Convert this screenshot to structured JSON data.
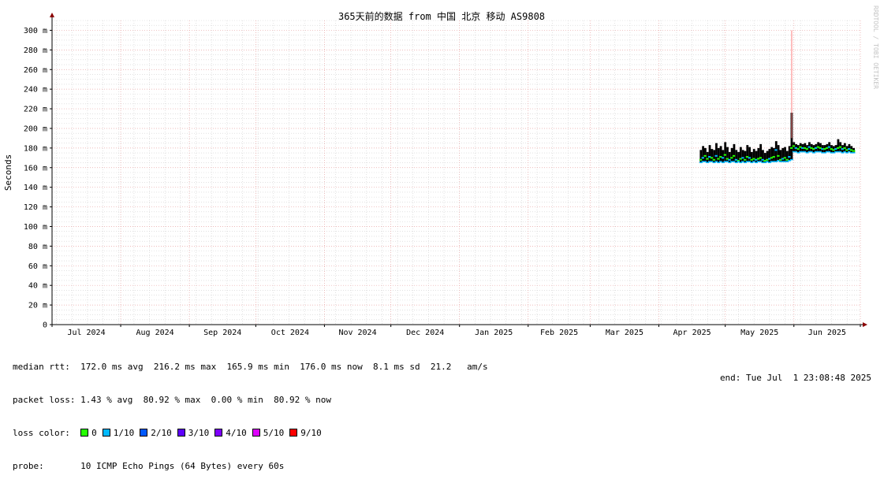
{
  "chart_data": {
    "type": "line",
    "title": "365天前的数据 from 中国 北京 移动 AS9808",
    "ylabel": "Seconds",
    "watermark": "RRDTOOL / TOBI OETIKER",
    "ylim": [
      0,
      310
    ],
    "yticks": [
      {
        "value": 0,
        "label": "0"
      },
      {
        "value": 20,
        "label": "20 m"
      },
      {
        "value": 40,
        "label": "40 m"
      },
      {
        "value": 60,
        "label": "60 m"
      },
      {
        "value": 80,
        "label": "80 m"
      },
      {
        "value": 100,
        "label": "100 m"
      },
      {
        "value": 120,
        "label": "120 m"
      },
      {
        "value": 140,
        "label": "140 m"
      },
      {
        "value": 160,
        "label": "160 m"
      },
      {
        "value": 180,
        "label": "180 m"
      },
      {
        "value": 200,
        "label": "200 m"
      },
      {
        "value": 220,
        "label": "220 m"
      },
      {
        "value": 240,
        "label": "240 m"
      },
      {
        "value": 260,
        "label": "260 m"
      },
      {
        "value": 280,
        "label": "280 m"
      },
      {
        "value": 300,
        "label": "300 m"
      }
    ],
    "xrange_days": [
      0,
      365
    ],
    "month_boundaries_days": [
      0,
      31,
      62,
      92,
      123,
      153,
      184,
      215,
      243,
      274,
      304,
      335,
      365
    ],
    "month_labels": [
      "Jul 2024",
      "Aug 2024",
      "Sep 2024",
      "Oct 2024",
      "Nov 2024",
      "Dec 2024",
      "Jan 2025",
      "Feb 2025",
      "Mar 2025",
      "Apr 2025",
      "May 2025",
      "Jun 2025"
    ],
    "grid": true,
    "series": [
      {
        "name": "median rtt",
        "x_days": [
          293,
          294,
          295,
          296,
          297,
          298,
          299,
          300,
          301,
          302,
          303,
          304,
          305,
          306,
          307,
          308,
          309,
          310,
          311,
          312,
          313,
          314,
          315,
          316,
          317,
          318,
          319,
          320,
          321,
          322,
          323,
          324,
          325,
          326,
          327,
          328,
          329,
          330,
          331,
          332,
          333,
          334,
          335,
          336,
          337,
          338,
          339,
          340,
          341,
          342,
          343,
          344,
          345,
          346,
          347,
          348,
          349,
          350,
          351,
          352,
          353,
          354,
          355,
          356,
          357,
          358,
          359,
          360,
          361,
          362
        ],
        "median_ms": [
          168,
          170,
          172,
          169,
          171,
          170,
          168,
          172,
          169,
          171,
          170,
          173,
          169,
          168,
          170,
          172,
          168,
          167,
          169,
          170,
          168,
          171,
          170,
          168,
          169,
          168,
          169,
          170,
          168,
          167,
          168,
          169,
          170,
          171,
          178,
          172,
          168,
          169,
          170,
          168,
          171,
          180,
          182,
          180,
          179,
          181,
          180,
          180,
          179,
          181,
          180,
          179,
          180,
          181,
          180,
          179,
          179,
          180,
          181,
          179,
          178,
          179,
          180,
          181,
          179,
          180,
          178,
          179,
          178,
          177
        ],
        "max_ms": [
          178,
          182,
          180,
          176,
          183,
          179,
          178,
          185,
          180,
          182,
          178,
          186,
          181,
          176,
          180,
          184,
          178,
          176,
          181,
          178,
          177,
          183,
          181,
          176,
          179,
          177,
          180,
          184,
          178,
          175,
          177,
          179,
          181,
          180,
          187,
          183,
          178,
          180,
          181,
          177,
          182,
          216,
          186,
          184,
          183,
          185,
          184,
          185,
          183,
          186,
          184,
          183,
          184,
          186,
          185,
          183,
          183,
          184,
          186,
          183,
          182,
          183,
          189,
          186,
          183,
          185,
          182,
          184,
          182,
          180
        ],
        "min_ms": [
          165,
          166,
          166,
          165,
          166,
          166,
          165,
          166,
          165,
          166,
          165,
          166,
          166,
          165,
          166,
          166,
          165,
          166,
          165,
          166,
          165,
          166,
          166,
          165,
          166,
          165,
          166,
          166,
          165,
          165,
          166,
          165,
          166,
          166,
          166,
          167,
          166,
          166,
          166,
          166,
          167,
          168,
          176,
          176,
          175,
          176,
          176,
          176,
          175,
          176,
          176,
          175,
          176,
          176,
          176,
          175,
          175,
          176,
          176,
          175,
          175,
          176,
          176,
          176,
          175,
          176,
          175,
          176,
          175,
          175
        ]
      }
    ],
    "spike": {
      "day": 334,
      "value_ms": 300
    }
  },
  "legend": {
    "median_rtt_label": "median rtt:",
    "median_rtt_values": "172.0 ms avg  216.2 ms max  165.9 ms min  176.0 ms now  8.1 ms sd  21.2   am/s",
    "packet_loss_label": "packet loss:",
    "packet_loss_values": "1.43 % avg  80.92 % max  0.00 % min  80.92 % now",
    "loss_color_label": "loss color:",
    "loss_colors": [
      {
        "label": "0",
        "color": "#26ff00"
      },
      {
        "label": "1/10",
        "color": "#00b8ff"
      },
      {
        "label": "2/10",
        "color": "#0059ff"
      },
      {
        "label": "3/10",
        "color": "#5e00ff"
      },
      {
        "label": "4/10",
        "color": "#7e00ff"
      },
      {
        "label": "5/10",
        "color": "#dd00ff"
      },
      {
        "label": "9/10",
        "color": "#ff0000"
      }
    ],
    "probe_label": "probe:",
    "probe_value": "10 ICMP Echo Pings (64 Bytes) every 60s",
    "end_text": "end: Tue Jul  1 23:08:48 2025"
  },
  "colors": {
    "major_grid": "#e8a3a3",
    "minor_grid": "#cfcfcf",
    "axis": "#000000",
    "arrow": "#8b0000",
    "smoke": "#000000",
    "spike": "#ff8080"
  }
}
